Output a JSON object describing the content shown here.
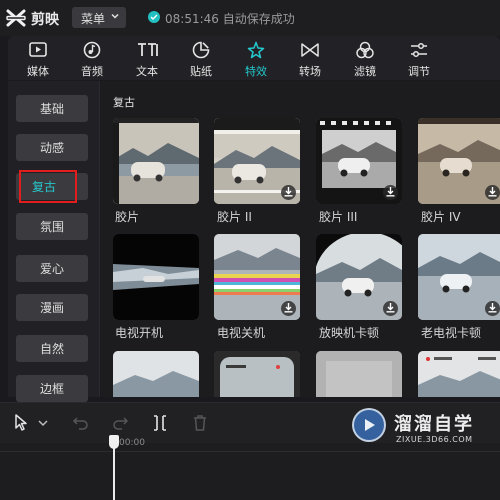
{
  "app": {
    "name": "剪映"
  },
  "menu": {
    "label": "菜单"
  },
  "status": {
    "time": "08:51:46",
    "text": "自动保存成功",
    "accent": "#25c8cc"
  },
  "toolbar": {
    "items": [
      {
        "label": "媒体",
        "icon": "media-icon"
      },
      {
        "label": "音频",
        "icon": "audio-icon"
      },
      {
        "label": "文本",
        "icon": "text-icon"
      },
      {
        "label": "贴纸",
        "icon": "sticker-icon"
      },
      {
        "label": "特效",
        "icon": "effects-icon",
        "active": true
      },
      {
        "label": "转场",
        "icon": "transition-icon"
      },
      {
        "label": "滤镜",
        "icon": "filter-icon"
      },
      {
        "label": "调节",
        "icon": "adjust-icon"
      }
    ]
  },
  "categories": {
    "items": [
      {
        "label": "基础"
      },
      {
        "label": "动感"
      },
      {
        "label": "复古",
        "active": true
      },
      {
        "label": "氛围"
      },
      {
        "label": "爱心"
      },
      {
        "label": "漫画"
      },
      {
        "label": "自然"
      },
      {
        "label": "边框"
      }
    ]
  },
  "effects": {
    "section_title": "复古",
    "items": [
      {
        "label": "胶片"
      },
      {
        "label": "胶片 II"
      },
      {
        "label": "胶片 III"
      },
      {
        "label": "胶片 IV"
      },
      {
        "label": "电视开机"
      },
      {
        "label": "电视关机"
      },
      {
        "label": "放映机卡顿"
      },
      {
        "label": "老电视卡顿"
      },
      {
        "label": ""
      },
      {
        "label": ""
      },
      {
        "label": ""
      },
      {
        "label": ""
      }
    ]
  },
  "timeline": {
    "timecode": "00:00"
  },
  "watermark": {
    "title": "溜溜自学",
    "url": "ZIXUE.3D66.COM"
  }
}
